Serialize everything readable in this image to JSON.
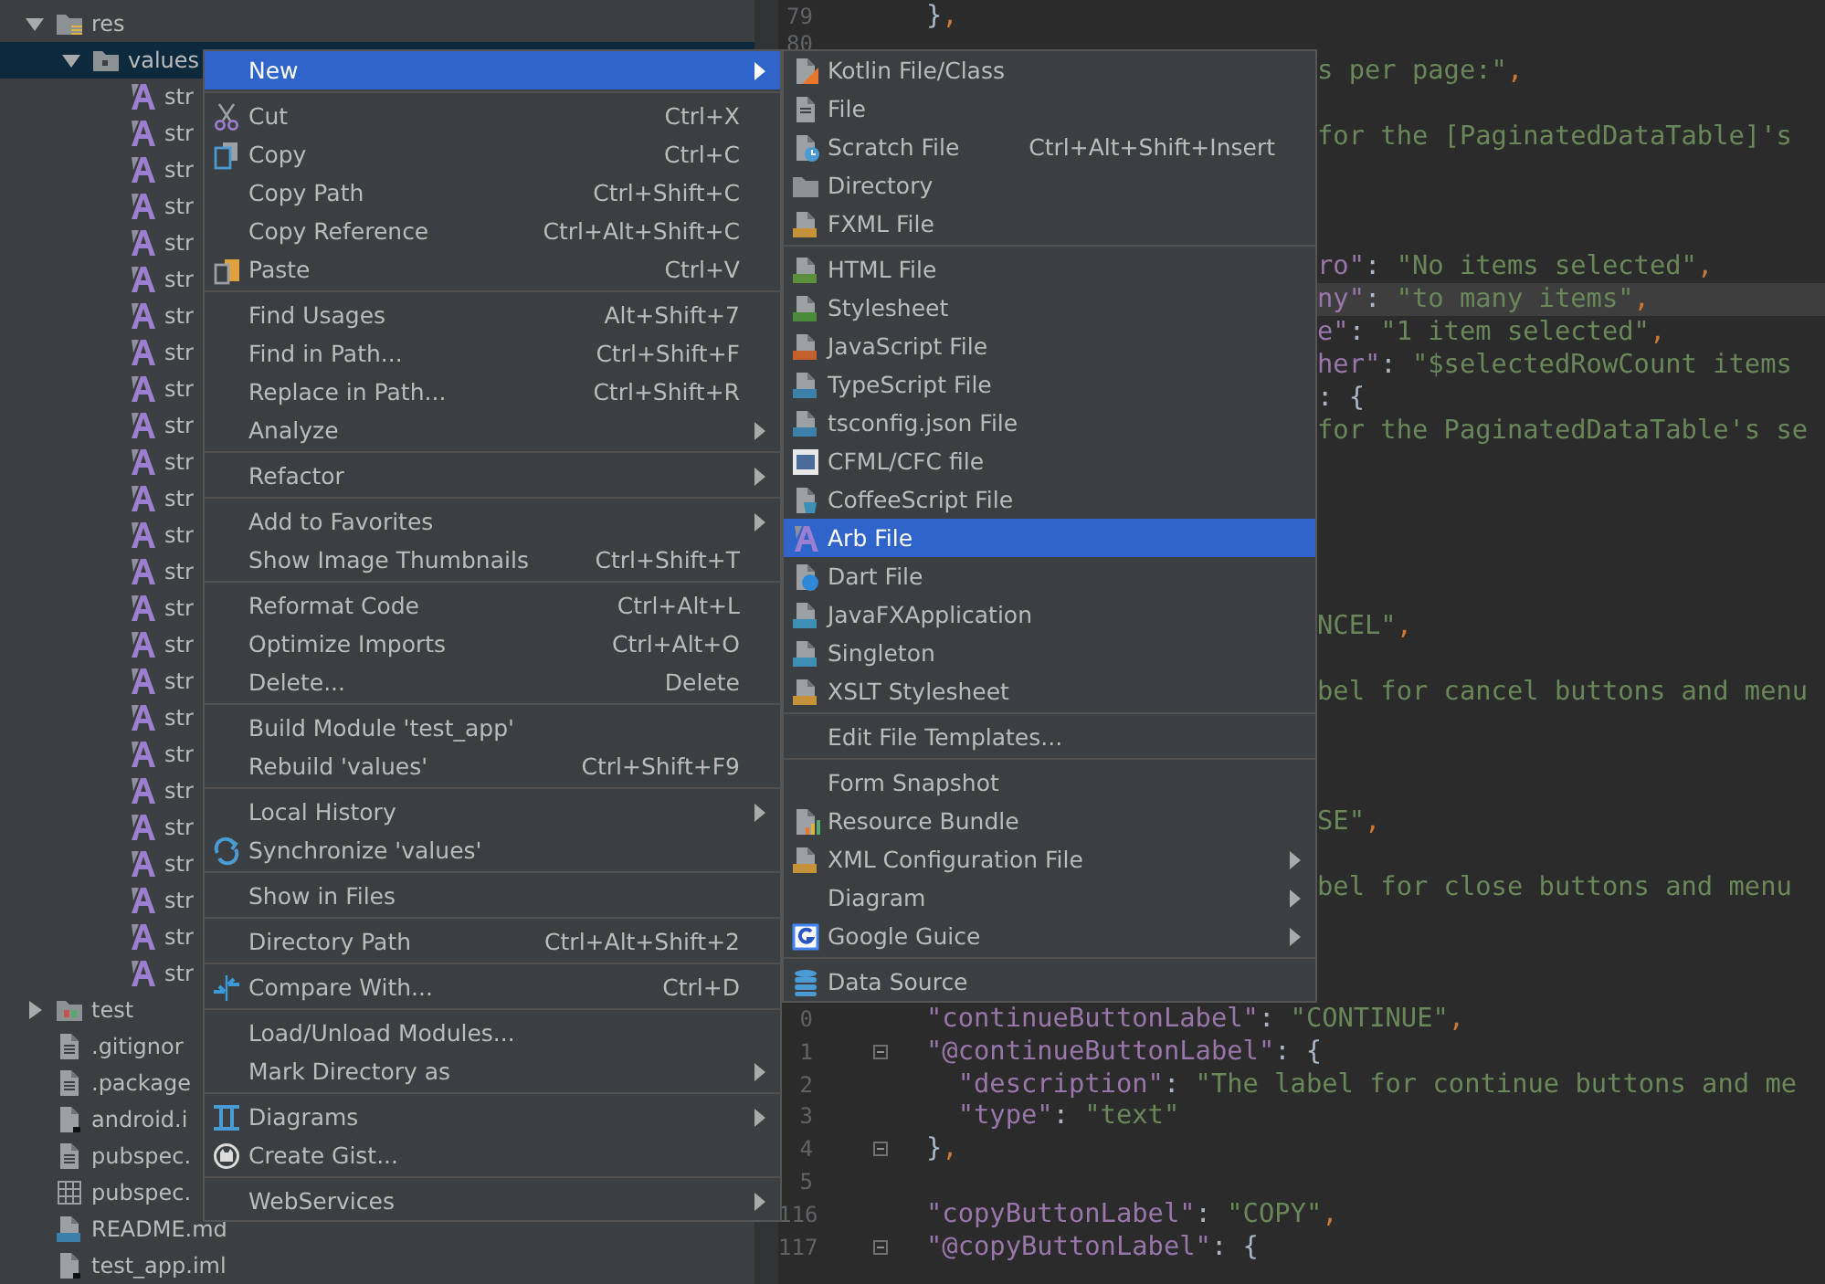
{
  "tree": [
    {
      "label": "res",
      "kind": "resources",
      "expanded": true,
      "selected": false,
      "children": [
        {
          "label": "values",
          "kind": "folder",
          "expanded": true,
          "selected": true,
          "children": [
            {
              "label": "str",
              "kind": "arb",
              "selected": false
            },
            {
              "label": "str",
              "kind": "arb",
              "selected": false
            },
            {
              "label": "str",
              "kind": "arb",
              "selected": false
            },
            {
              "label": "str",
              "kind": "arb",
              "selected": false
            },
            {
              "label": "str",
              "kind": "arb",
              "selected": false
            },
            {
              "label": "str",
              "kind": "arb",
              "selected": false
            },
            {
              "label": "str",
              "kind": "arb",
              "selected": false
            },
            {
              "label": "str",
              "kind": "arb",
              "selected": false
            },
            {
              "label": "str",
              "kind": "arb",
              "selected": false
            },
            {
              "label": "str",
              "kind": "arb",
              "selected": false
            },
            {
              "label": "str",
              "kind": "arb",
              "selected": false
            },
            {
              "label": "str",
              "kind": "arb",
              "selected": false
            },
            {
              "label": "str",
              "kind": "arb",
              "selected": false
            },
            {
              "label": "str",
              "kind": "arb",
              "selected": false
            },
            {
              "label": "str",
              "kind": "arb",
              "selected": false
            },
            {
              "label": "str",
              "kind": "arb",
              "selected": false
            },
            {
              "label": "str",
              "kind": "arb",
              "selected": false
            },
            {
              "label": "str",
              "kind": "arb",
              "selected": false
            },
            {
              "label": "str",
              "kind": "arb",
              "selected": false
            },
            {
              "label": "str",
              "kind": "arb",
              "selected": false
            },
            {
              "label": "str",
              "kind": "arb",
              "selected": false
            },
            {
              "label": "str",
              "kind": "arb",
              "selected": false
            },
            {
              "label": "str",
              "kind": "arb",
              "selected": false
            },
            {
              "label": "str",
              "kind": "arb",
              "selected": false
            },
            {
              "label": "str",
              "kind": "arb",
              "selected": false
            }
          ]
        }
      ]
    },
    {
      "label": "test",
      "kind": "test-folder",
      "expanded": false,
      "selected": false
    },
    {
      "label": ".gitignor",
      "kind": "text",
      "selected": false
    },
    {
      "label": ".package",
      "kind": "text",
      "selected": false
    },
    {
      "label": "android.i",
      "kind": "iml",
      "selected": false
    },
    {
      "label": "pubspec.",
      "kind": "text",
      "selected": false
    },
    {
      "label": "pubspec.",
      "kind": "table",
      "selected": false
    },
    {
      "label": "README.md",
      "kind": "markdown",
      "selected": false
    },
    {
      "label": "test_app.iml",
      "kind": "iml",
      "selected": false
    }
  ],
  "editor": {
    "rows": [
      {
        "kind": "full",
        "number": "79",
        "current": false,
        "fold": false,
        "tokens": [
          {
            "text": "}",
            "kind": "p"
          },
          {
            "text": ",",
            "kind": "c"
          }
        ]
      },
      {
        "kind": "full",
        "number": "80",
        "current": false,
        "fold": false
      },
      {
        "kind": "clipped",
        "current": false,
        "tokens": [
          {
            "text": "s per page:\"",
            "kind": "s"
          },
          {
            "text": ",",
            "kind": "c"
          }
        ]
      },
      {
        "kind": "blank",
        "current": false
      },
      {
        "kind": "clipped",
        "current": false,
        "tokens": [
          {
            "text": "for the [PaginatedDataTable]'s",
            "kind": "s"
          }
        ]
      },
      {
        "kind": "blank",
        "current": false
      },
      {
        "kind": "blank",
        "current": false
      },
      {
        "kind": "blank",
        "current": false
      },
      {
        "kind": "clipped",
        "current": false,
        "tokens": [
          {
            "text": "ro\"",
            "kind": "k"
          },
          {
            "text": ": ",
            "kind": "p"
          },
          {
            "text": "\"No items selected\"",
            "kind": "s"
          },
          {
            "text": ",",
            "kind": "c"
          }
        ]
      },
      {
        "kind": "clipped",
        "current": true,
        "tokens": [
          {
            "text": "ny\"",
            "kind": "k"
          },
          {
            "text": ": ",
            "kind": "p"
          },
          {
            "text": "\"to many items\"",
            "kind": "s"
          },
          {
            "text": ",",
            "kind": "c"
          }
        ]
      },
      {
        "kind": "clipped",
        "current": false,
        "tokens": [
          {
            "text": "e\"",
            "kind": "k"
          },
          {
            "text": ": ",
            "kind": "p"
          },
          {
            "text": "\"1 item selected\"",
            "kind": "s"
          },
          {
            "text": ",",
            "kind": "c"
          }
        ]
      },
      {
        "kind": "clipped",
        "current": false,
        "tokens": [
          {
            "text": "her\"",
            "kind": "k"
          },
          {
            "text": ": ",
            "kind": "p"
          },
          {
            "text": "\"$selectedRowCount items",
            "kind": "s"
          }
        ]
      },
      {
        "kind": "clipped",
        "current": false,
        "tokens": [
          {
            "text": ": {",
            "kind": "p"
          }
        ]
      },
      {
        "kind": "clipped",
        "current": false,
        "tokens": [
          {
            "text": "for the PaginatedDataTable's se",
            "kind": "s"
          }
        ]
      },
      {
        "kind": "blank",
        "current": false
      },
      {
        "kind": "blank",
        "current": false
      },
      {
        "kind": "blank",
        "current": false
      },
      {
        "kind": "blank",
        "current": false
      },
      {
        "kind": "blank",
        "current": false
      },
      {
        "kind": "clipped",
        "current": false,
        "tokens": [
          {
            "text": "NCEL\"",
            "kind": "s"
          },
          {
            "text": ",",
            "kind": "c"
          }
        ]
      },
      {
        "kind": "blank",
        "current": false
      },
      {
        "kind": "clipped",
        "current": false,
        "tokens": [
          {
            "text": "bel for cancel buttons and menu",
            "kind": "s"
          }
        ]
      },
      {
        "kind": "blank",
        "current": false
      },
      {
        "kind": "blank",
        "current": false
      },
      {
        "kind": "blank",
        "current": false
      },
      {
        "kind": "clipped",
        "current": false,
        "tokens": [
          {
            "text": "SE\"",
            "kind": "s"
          },
          {
            "text": ",",
            "kind": "c"
          }
        ]
      },
      {
        "kind": "blank",
        "current": false
      },
      {
        "kind": "clipped",
        "current": false,
        "tokens": [
          {
            "text": "bel for close buttons and menu",
            "kind": "s"
          }
        ]
      },
      {
        "kind": "blank",
        "current": false
      },
      {
        "kind": "blank",
        "current": false
      },
      {
        "kind": "blank",
        "current": false
      },
      {
        "kind": "full",
        "number": "0",
        "current": false,
        "fold": false,
        "tokens": [
          {
            "text": "\"continueButtonLabel\"",
            "kind": "k"
          },
          {
            "text": ": ",
            "kind": "p"
          },
          {
            "text": "\"CONTINUE\"",
            "kind": "s"
          },
          {
            "text": ",",
            "kind": "c"
          }
        ]
      },
      {
        "kind": "full",
        "number": "1",
        "current": false,
        "fold": true,
        "tokens": [
          {
            "text": "\"@continueButtonLabel\"",
            "kind": "k"
          },
          {
            "text": ": {",
            "kind": "p"
          }
        ]
      },
      {
        "kind": "full",
        "number": "2",
        "current": false,
        "fold": false,
        "tokens": [
          {
            "text": "  \"description\"",
            "kind": "k"
          },
          {
            "text": ": ",
            "kind": "p"
          },
          {
            "text": "\"The label for continue buttons and me",
            "kind": "s"
          }
        ]
      },
      {
        "kind": "full",
        "number": "3",
        "current": false,
        "fold": false,
        "tokens": [
          {
            "text": "  \"type\"",
            "kind": "k"
          },
          {
            "text": ": ",
            "kind": "p"
          },
          {
            "text": "\"text\"",
            "kind": "s"
          }
        ]
      },
      {
        "kind": "full",
        "number": "4",
        "current": false,
        "fold": true,
        "tokens": [
          {
            "text": "}",
            "kind": "p"
          },
          {
            "text": ",",
            "kind": "c"
          }
        ]
      },
      {
        "kind": "full",
        "number": "5",
        "current": false,
        "fold": false
      },
      {
        "kind": "full",
        "number": "116",
        "current": false,
        "fold": false,
        "tokens": [
          {
            "text": "\"copyButtonLabel\"",
            "kind": "k"
          },
          {
            "text": ": ",
            "kind": "p"
          },
          {
            "text": "\"COPY\"",
            "kind": "s"
          },
          {
            "text": ",",
            "kind": "c"
          }
        ]
      },
      {
        "kind": "full",
        "number": "117",
        "current": false,
        "fold": true,
        "tokens": [
          {
            "text": "\"@copyButtonLabel\"",
            "kind": "k"
          },
          {
            "text": ": {",
            "kind": "p"
          }
        ]
      }
    ]
  },
  "context_menu": {
    "groups": [
      [
        {
          "label": "New",
          "submenu": true,
          "selected": true
        }
      ],
      [
        {
          "label": "Cut",
          "shortcut": "Ctrl+X",
          "submenu": false,
          "selected": false
        },
        {
          "label": "Copy",
          "shortcut": "Ctrl+C",
          "submenu": false,
          "selected": false
        },
        {
          "label": "Copy Path",
          "shortcut": "Ctrl+Shift+C",
          "submenu": false,
          "selected": false
        },
        {
          "label": "Copy Reference",
          "shortcut": "Ctrl+Alt+Shift+C",
          "submenu": false,
          "selected": false
        },
        {
          "label": "Paste",
          "shortcut": "Ctrl+V",
          "submenu": false,
          "selected": false
        }
      ],
      [
        {
          "label": "Find Usages",
          "shortcut": "Alt+Shift+7",
          "submenu": false,
          "selected": false
        },
        {
          "label": "Find in Path...",
          "shortcut": "Ctrl+Shift+F",
          "submenu": false,
          "selected": false
        },
        {
          "label": "Replace in Path...",
          "shortcut": "Ctrl+Shift+R",
          "submenu": false,
          "selected": false
        },
        {
          "label": "Analyze",
          "submenu": true,
          "selected": false
        }
      ],
      [
        {
          "label": "Refactor",
          "submenu": true,
          "selected": false
        }
      ],
      [
        {
          "label": "Add to Favorites",
          "submenu": true,
          "selected": false
        },
        {
          "label": "Show Image Thumbnails",
          "shortcut": "Ctrl+Shift+T",
          "submenu": false,
          "selected": false
        }
      ],
      [
        {
          "label": "Reformat Code",
          "shortcut": "Ctrl+Alt+L",
          "submenu": false,
          "selected": false
        },
        {
          "label": "Optimize Imports",
          "shortcut": "Ctrl+Alt+O",
          "submenu": false,
          "selected": false
        },
        {
          "label": "Delete...",
          "shortcut": "Delete",
          "submenu": false,
          "selected": false
        }
      ],
      [
        {
          "label": "Build Module 'test_app'",
          "submenu": false,
          "selected": false
        },
        {
          "label": "Rebuild 'values'",
          "shortcut": "Ctrl+Shift+F9",
          "submenu": false,
          "selected": false
        }
      ],
      [
        {
          "label": "Local History",
          "submenu": true,
          "selected": false
        },
        {
          "label": "Synchronize 'values'",
          "submenu": false,
          "selected": false
        }
      ],
      [
        {
          "label": "Show in Files",
          "submenu": false,
          "selected": false
        }
      ],
      [
        {
          "label": "Directory Path",
          "shortcut": "Ctrl+Alt+Shift+2",
          "submenu": false,
          "selected": false
        }
      ],
      [
        {
          "label": "Compare With...",
          "shortcut": "Ctrl+D",
          "submenu": false,
          "selected": false
        }
      ],
      [
        {
          "label": "Load/Unload Modules...",
          "submenu": false,
          "selected": false
        },
        {
          "label": "Mark Directory as",
          "submenu": true,
          "selected": false
        }
      ],
      [
        {
          "label": "Diagrams",
          "submenu": true,
          "selected": false
        },
        {
          "label": "Create Gist...",
          "submenu": false,
          "selected": false
        }
      ],
      [
        {
          "label": "WebServices",
          "submenu": true,
          "selected": false
        }
      ]
    ]
  },
  "new_submenu": {
    "groups": [
      [
        {
          "label": "Kotlin File/Class",
          "submenu": false,
          "selected": false
        },
        {
          "label": "File",
          "submenu": false,
          "selected": false
        },
        {
          "label": "Scratch File",
          "shortcut": "Ctrl+Alt+Shift+Insert",
          "submenu": false,
          "selected": false
        },
        {
          "label": "Directory",
          "submenu": false,
          "selected": false
        },
        {
          "label": "FXML File",
          "submenu": false,
          "selected": false
        }
      ],
      [
        {
          "label": "HTML File",
          "submenu": false,
          "selected": false
        },
        {
          "label": "Stylesheet",
          "submenu": false,
          "selected": false
        },
        {
          "label": "JavaScript File",
          "submenu": false,
          "selected": false
        },
        {
          "label": "TypeScript File",
          "submenu": false,
          "selected": false
        },
        {
          "label": "tsconfig.json File",
          "submenu": false,
          "selected": false
        },
        {
          "label": "CFML/CFC file",
          "submenu": false,
          "selected": false
        },
        {
          "label": "CoffeeScript File",
          "submenu": false,
          "selected": false
        },
        {
          "label": "Arb File",
          "submenu": false,
          "selected": true
        },
        {
          "label": "Dart File",
          "submenu": false,
          "selected": false
        },
        {
          "label": "JavaFXApplication",
          "submenu": false,
          "selected": false
        },
        {
          "label": "Singleton",
          "submenu": false,
          "selected": false
        },
        {
          "label": "XSLT Stylesheet",
          "submenu": false,
          "selected": false
        }
      ],
      [
        {
          "label": "Edit File Templates...",
          "submenu": false,
          "selected": false
        }
      ],
      [
        {
          "label": "Form Snapshot",
          "submenu": false,
          "selected": false
        },
        {
          "label": "Resource Bundle",
          "submenu": false,
          "selected": false
        },
        {
          "label": "XML Configuration File",
          "submenu": true,
          "selected": false
        },
        {
          "label": "Diagram",
          "submenu": true,
          "selected": false
        },
        {
          "label": "Google Guice",
          "submenu": true,
          "selected": false
        }
      ],
      [
        {
          "label": "Data Source",
          "submenu": false,
          "selected": false
        }
      ]
    ]
  }
}
